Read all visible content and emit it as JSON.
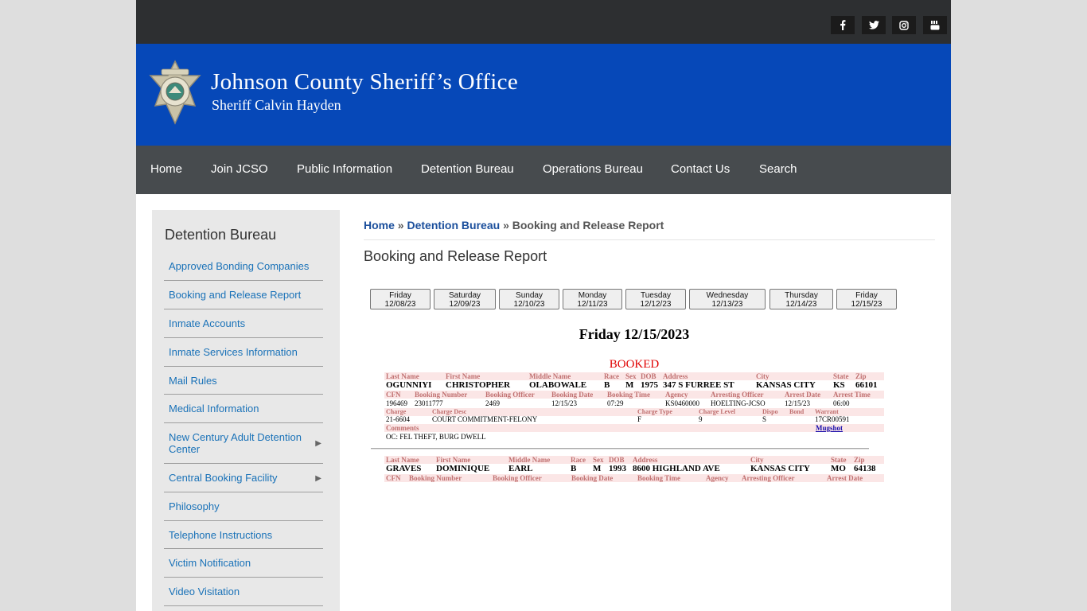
{
  "header": {
    "site_title": "Johnson County Sheriff’s Office",
    "site_subtitle": "Sheriff Calvin Hayden",
    "social": [
      "facebook-icon",
      "twitter-icon",
      "instagram-icon",
      "youtube-icon"
    ]
  },
  "nav": [
    "Home",
    "Join JCSO",
    "Public Information",
    "Detention Bureau",
    "Operations Bureau",
    "Contact Us",
    "Search"
  ],
  "sidebar": {
    "title": "Detention Bureau",
    "items": [
      {
        "label": "Approved Bonding Companies"
      },
      {
        "label": "Booking and Release Report"
      },
      {
        "label": "Inmate Accounts"
      },
      {
        "label": "Inmate Services Information"
      },
      {
        "label": "Mail Rules"
      },
      {
        "label": "Medical Information"
      },
      {
        "label": "New Century Adult Detention Center",
        "line1": "New Century Adult Detention",
        "line2": "Center"
      },
      {
        "label": "Central Booking Facility"
      },
      {
        "label": "Philosophy"
      },
      {
        "label": "Telephone Instructions"
      },
      {
        "label": "Victim Notification"
      },
      {
        "label": "Video Visitation"
      }
    ]
  },
  "breadcrumb": {
    "home": "Home",
    "sep": "»",
    "section": "Detention Bureau",
    "current": "Booking and Release Report"
  },
  "page_title": "Booking and Release Report",
  "days": [
    {
      "day": "Friday",
      "date": "12/08/23"
    },
    {
      "day": "Saturday",
      "date": "12/09/23"
    },
    {
      "day": "Sunday",
      "date": "12/10/23"
    },
    {
      "day": "Monday",
      "date": "12/11/23"
    },
    {
      "day": "Tuesday",
      "date": "12/12/23"
    },
    {
      "day": "Wednesday",
      "date": "12/13/23"
    },
    {
      "day": "Thursday",
      "date": "12/14/23"
    },
    {
      "day": "Friday",
      "date": "12/15/23"
    }
  ],
  "report": {
    "date_heading": "Friday 12/15/2023",
    "section_label": "BOOKED",
    "labels": {
      "last_name": "Last Name",
      "first_name": "First Name",
      "middle_name": "Middle Name",
      "race": "Race",
      "sex": "Sex",
      "dob": "DOB",
      "address": "Address",
      "city": "City",
      "state": "State",
      "zip": "Zip",
      "cfn": "CFN",
      "booking_number": "Booking Number",
      "booking_officer": "Booking Officer",
      "booking_date": "Booking Date",
      "booking_time": "Booking Time",
      "agency": "Agency",
      "arresting_officer": "Arresting Officer",
      "arrest_date": "Arrest Date",
      "arrest_time": "Arrest Time",
      "charge": "Charge",
      "charge_desc": "Charge Desc",
      "charge_type": "Charge Type",
      "charge_level": "Charge Level",
      "dispo": "Dispo",
      "bond": "Bond",
      "warrant": "Warrant",
      "comments": "Comments",
      "mugshot": "Mugshot"
    },
    "records": [
      {
        "last_name": "OGUNNIYI",
        "first_name": "CHRISTOPHER",
        "middle_name": "OLABOWALE",
        "race": "B",
        "sex": "M",
        "dob": "1975",
        "address": "347 S FURREE ST",
        "city": "KANSAS CITY",
        "state": "KS",
        "zip": "66101",
        "cfn": "196469",
        "booking_number": "23011777",
        "booking_officer": "2469",
        "booking_date": "12/15/23",
        "booking_time": "07:29",
        "agency": "KS0460000",
        "arresting_officer": "HOELTING-JCSO",
        "arrest_date": "12/15/23",
        "arrest_time": "06:00",
        "charge": "21-6604",
        "charge_desc": "COURT COMMITMENT-FELONY",
        "charge_type": "F",
        "charge_level": "9",
        "dispo": "S",
        "warrant": "17CR00591",
        "comments": "OC: FEL THEFT, BURG DWELL"
      },
      {
        "last_name": "GRAVES",
        "first_name": "DOMINIQUE",
        "middle_name": "EARL",
        "race": "B",
        "sex": "M",
        "dob": "1993",
        "address": "8600 HIGHLAND AVE",
        "city": "KANSAS CITY",
        "state": "MO",
        "zip": "64138"
      }
    ]
  }
}
